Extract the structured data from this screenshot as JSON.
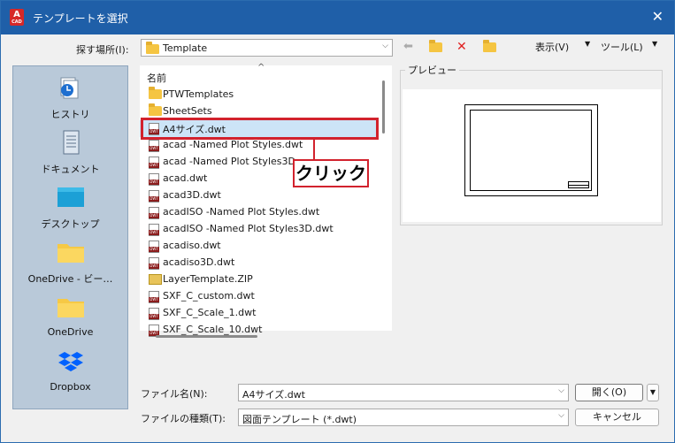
{
  "window": {
    "title": "テンプレートを選択",
    "app_icon_letter": "A",
    "app_icon_sub": "CAD"
  },
  "toolbar": {
    "lookin_label": "探す場所(I):",
    "lookin_value": "Template",
    "view_label": "表示(V)",
    "tools_label": "ツール(L)"
  },
  "places": [
    "ヒストリ",
    "ドキュメント",
    "デスクトップ",
    "OneDrive - ビー…",
    "OneDrive",
    "Dropbox"
  ],
  "filelist": {
    "header": "名前",
    "files": [
      {
        "name": "PTWTemplates",
        "type": "folder"
      },
      {
        "name": "SheetSets",
        "type": "folder"
      },
      {
        "name": "A4サイズ.dwt",
        "type": "dwt",
        "selected": true
      },
      {
        "name": "acad -Named Plot Styles.dwt",
        "type": "dwt"
      },
      {
        "name": "acad -Named Plot Styles3D.",
        "type": "dwt"
      },
      {
        "name": "acad.dwt",
        "type": "dwt"
      },
      {
        "name": "acad3D.dwt",
        "type": "dwt"
      },
      {
        "name": "acadISO -Named Plot Styles.dwt",
        "type": "dwt"
      },
      {
        "name": "acadISO -Named Plot Styles3D.dwt",
        "type": "dwt"
      },
      {
        "name": "acadiso.dwt",
        "type": "dwt"
      },
      {
        "name": "acadiso3D.dwt",
        "type": "dwt"
      },
      {
        "name": "LayerTemplate.ZIP",
        "type": "zip"
      },
      {
        "name": "SXF_C_custom.dwt",
        "type": "dwt"
      },
      {
        "name": "SXF_C_Scale_1.dwt",
        "type": "dwt"
      },
      {
        "name": "SXF_C_Scale_10.dwt",
        "type": "dwt"
      }
    ]
  },
  "annotation": {
    "callout_text": "クリック",
    "color": "#d2222d"
  },
  "preview": {
    "label": "プレビュー"
  },
  "bottom": {
    "filename_label": "ファイル名(N):",
    "filename_value": "A4サイズ.dwt",
    "filetype_label": "ファイルの種類(T):",
    "filetype_value": "図面テンプレート (*.dwt)",
    "open_button": "開く(O)",
    "cancel_button": "キャンセル"
  }
}
